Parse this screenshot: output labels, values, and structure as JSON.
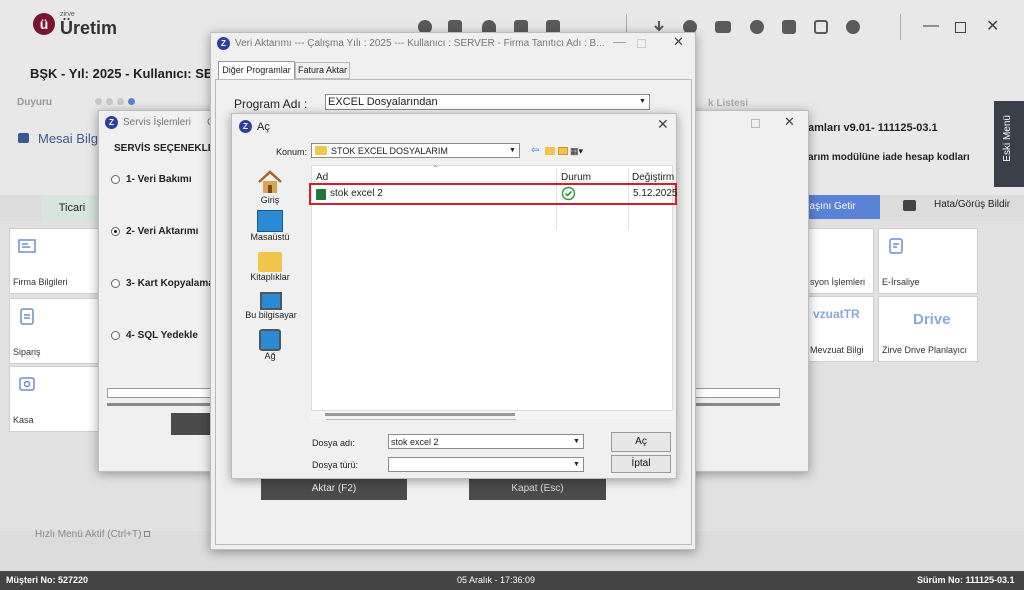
{
  "app": {
    "logo_letter": "ü",
    "logo_small": "zirve",
    "logo_text": "Üretim",
    "header_text": "BŞK - Yıl: 2025 - Kullanıcı: SE",
    "duyuru": "Duyuru",
    "mesai": "Mesai Bilgi",
    "tab_ticari": "Ticari",
    "right_version": "amları v9.01- 111125-03.1",
    "right_notice": "arım modülüne iade hesap kodları",
    "partial_list": "k Listesi",
    "getir": "daşını Getir",
    "hata": "Hata/Görüş Bildir",
    "eski_menu": "Eski Menü",
    "hizli": "Hızlı Menü Aktif (Ctrl+T)",
    "tiles_left": [
      "Firma Bilgileri",
      "Sipariş",
      "Kasa"
    ],
    "tiles_right": [
      {
        "label": "syon İşlemleri",
        "logo": ""
      },
      {
        "label": "E-İrsaliye",
        "logo": ""
      },
      {
        "label": "Mevzuat Bilgi",
        "logo": "vzuatTR"
      },
      {
        "label": "Zirve Drive Planlayıcı",
        "logo": "Drive"
      }
    ],
    "status_left": "Müşteri No: 527220",
    "status_center": "05 Aralık - 17:36:09",
    "status_right": "Sürüm No: 111125-03.1",
    "accent": "#5a82d6",
    "brand": "#7a1530"
  },
  "servis": {
    "title": "Servis İşlemleri",
    "title_tail": "C",
    "section": "SERVİS SEÇENEKLER",
    "options": [
      "1- Veri Bakımı",
      "2- Veri Aktarımı",
      "3- Kart Kopyalama",
      "4- SQL Yedekle"
    ],
    "selected_index": 1
  },
  "veri": {
    "title": "Veri Aktarımı  ---  Çalışma Yılı : 2025  ---  Kullanıcı : SERVER - Firma Tanıtıcı Adı : B...",
    "tabs": [
      "Diğer Programlar",
      "Fatura Aktar"
    ],
    "program_label": "Program Adı :",
    "program_value": "EXCEL Dosyalarından",
    "aktar_button": "Aktar (F2)",
    "kapat_button": "Kapat (Esc)"
  },
  "ac": {
    "title": "Aç",
    "konum_label": "Konum:",
    "konum_value": "STOK EXCEL DOSYALARIM",
    "places": [
      "Giriş",
      "Masaüstü",
      "Kitaplıklar",
      "Bu bilgisayar",
      "Ağ"
    ],
    "columns": [
      "Ad",
      "Durum",
      "Değiştirm"
    ],
    "files": [
      {
        "name": "stok excel 2",
        "status_icon": "synced-check-icon",
        "modified": "5.12.2025"
      }
    ],
    "filename_label": "Dosya adı:",
    "filename_value": "stok excel 2",
    "filetype_label": "Dosya türü:",
    "filetype_value": "",
    "open_button": "Aç",
    "cancel_button": "İptal",
    "highlight_color": "#d0202a"
  }
}
